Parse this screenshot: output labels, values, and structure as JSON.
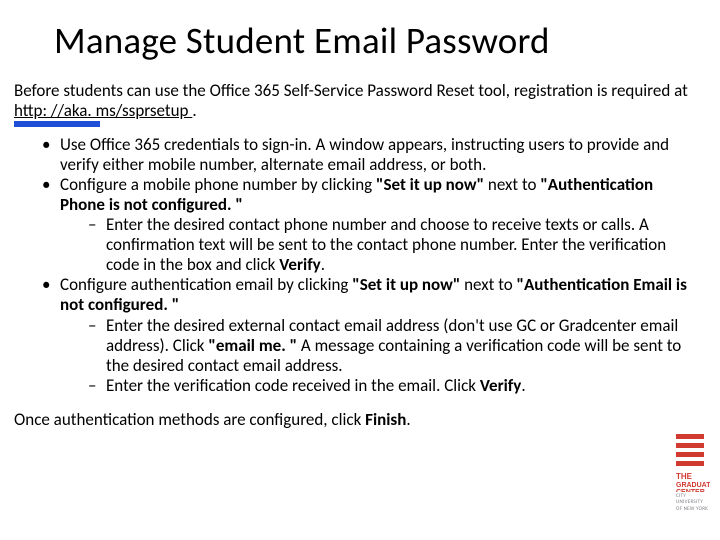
{
  "title": "Manage Student Email Password",
  "intro_prefix": "Before students can use the Office 365 Self-Service Password Reset tool, registration is required at ",
  "intro_link": "http: //aka. ms/ssprsetup",
  "intro_suffix": ".",
  "bullets": {
    "b1": "Use Office 365 credentials to sign-in. A window appears, instructing users to provide and verify either mobile number, alternate email address, or both.",
    "b2_pre": "Configure a mobile phone number by clicking  ",
    "b2_bold1": "\"Set it up now\"",
    "b2_mid": " next to ",
    "b2_bold2": "\"Authentication Phone is not configured. \"",
    "b2_sub1_pre": "Enter the desired contact phone number and choose to receive texts or calls. A confirmation text will be sent to the contact phone number. Enter the verification code in the box and click ",
    "b2_sub1_bold": "Verify",
    "b2_sub1_post": ".",
    "b3_pre": "Configure authentication email by clicking ",
    "b3_bold1": "\"Set it up now\"",
    "b3_mid": " next to ",
    "b3_bold2": "\"Authentication Email is not configured. \"",
    "b3_sub1_pre": "Enter the desired external contact email address (don't use GC or Gradcenter email address). Click ",
    "b3_sub1_bold": "\"email me. \"",
    "b3_sub1_post": " A message containing a verification code will be sent to the desired contact email address.",
    "b3_sub2_pre": "Enter the verification code received in the email. Click ",
    "b3_sub2_bold": "Verify",
    "b3_sub2_post": "."
  },
  "closing_pre": "Once authentication methods are configured, click ",
  "closing_bold": "Finish",
  "closing_post": ".",
  "brand": {
    "line1": "CITY UNIVERSITY",
    "line2": "OF NEW YORK",
    "color": "#d13a2f"
  }
}
